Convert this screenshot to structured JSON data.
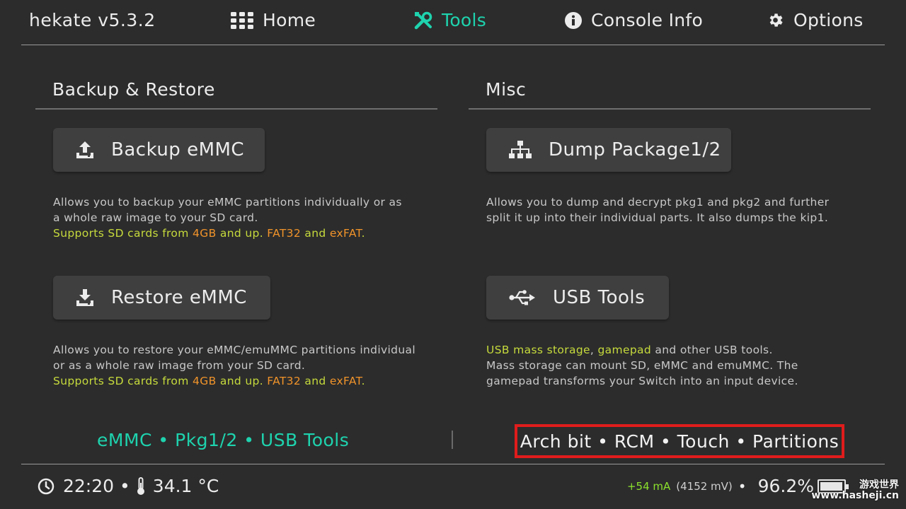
{
  "app": {
    "title": "hekate v5.3.2"
  },
  "nav": {
    "tabs": [
      {
        "label": "Home",
        "icon": "grid-icon"
      },
      {
        "label": "Tools",
        "icon": "tools-icon",
        "active": true
      },
      {
        "label": "Console Info",
        "icon": "info-icon"
      },
      {
        "label": "Options",
        "icon": "gear-icon"
      }
    ]
  },
  "sections": {
    "backup": {
      "title": "Backup & Restore",
      "backup_button": "Backup eMMC",
      "backup_desc_1": "Allows you to backup your eMMC partitions individually or as",
      "backup_desc_2": "a whole raw image to your SD card.",
      "restore_button": "Restore eMMC",
      "restore_desc_1": "Allows you to restore your eMMC/emuMMC partitions individual",
      "restore_desc_2": "or as a whole raw image from your SD card.",
      "support": {
        "p1": "Supports SD cards from ",
        "p2": "4GB",
        "p3": " and up. ",
        "p4": "FAT32",
        "p5": " and ",
        "p6": "exFAT",
        "p7": "."
      }
    },
    "misc": {
      "title": "Misc",
      "dump_button": "Dump Package1/2",
      "dump_desc_1": "Allows you to dump and decrypt pkg1 and pkg2 and further",
      "dump_desc_2": "split it up into their individual parts. It also dumps the kip1.",
      "usb_button": "USB Tools",
      "usb_desc": {
        "p1": "USB mass storage",
        "p2": ", ",
        "p3": "gamepad",
        "p4": " and other USB tools."
      },
      "usb_desc_2": "Mass storage can mount SD, eMMC and emuMMC. The",
      "usb_desc_3": "gamepad transforms your Switch into an input device."
    }
  },
  "footer_links": {
    "left": "eMMC • Pkg1/2 • USB Tools",
    "right": "Arch bit • RCM • Touch • Partitions"
  },
  "status": {
    "time": "22:20",
    "temperature": "34.1 °C",
    "current": "+54 mA",
    "voltage": "(4152 mV)",
    "battery_percent": "96.2%",
    "battery_level": 0.962
  },
  "watermark": {
    "line1": "游戏世界",
    "line2": "www.hasheji.cn"
  },
  "colors": {
    "accent": "#1ed3ae",
    "highlight_yellow": "#c6da3c",
    "highlight_orange": "#f0932a",
    "annotation_red": "#e01c1c"
  }
}
